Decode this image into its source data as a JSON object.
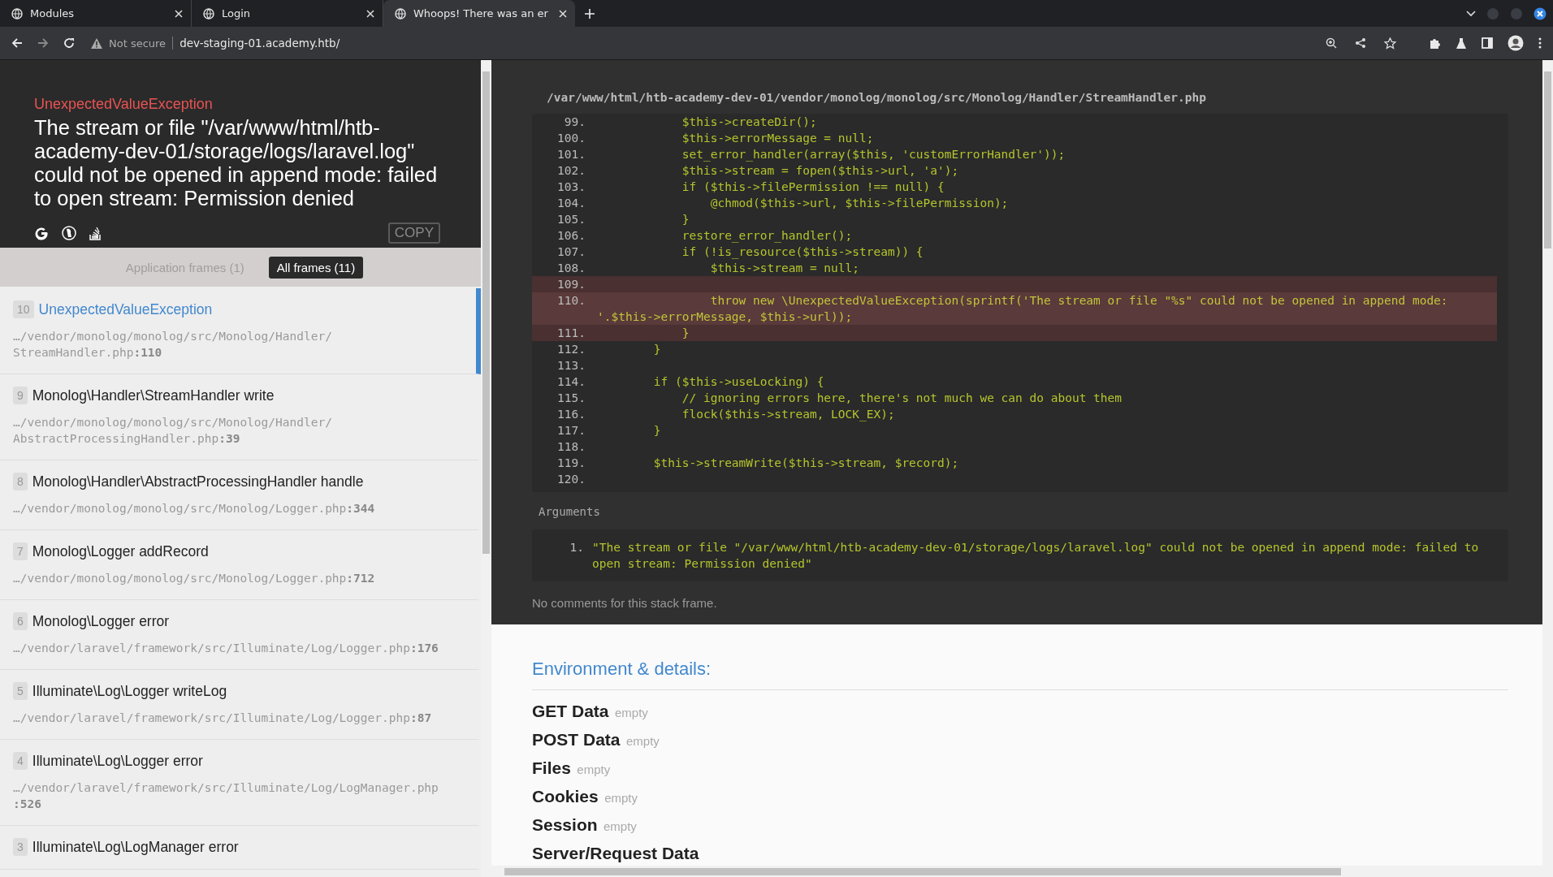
{
  "browser": {
    "tabs": [
      {
        "title": "Modules",
        "selected": false
      },
      {
        "title": "Login",
        "selected": false
      },
      {
        "title": "Whoops! There was an er",
        "selected": true
      }
    ],
    "address": {
      "security": "Not secure",
      "url": "dev-staging-01.academy.htb/"
    }
  },
  "header": {
    "exception": "UnexpectedValueException",
    "message": "The stream or file \"/var/www/html/htb-academy-dev-01/storage/logs/laravel.log\" could not be opened in append mode: failed to open stream: Permission denied",
    "copy_label": "COPY"
  },
  "frame_filters": [
    {
      "label": "Application frames (1)",
      "selected": false
    },
    {
      "label": "All frames (11)",
      "selected": true
    }
  ],
  "frames": [
    {
      "number": "10",
      "title": "UnexpectedValueException",
      "file": "…/vendor/monolog/monolog/src/Monolog/Handler/StreamHandler.php",
      "line": ":110",
      "selected": true
    },
    {
      "number": "9",
      "title": "Monolog\\Handler\\StreamHandler write",
      "file": "…/vendor/monolog/monolog/src/Monolog/Handler/AbstractProcessingHandler.php",
      "line": ":39",
      "selected": false
    },
    {
      "number": "8",
      "title": "Monolog\\Handler\\AbstractProcessingHandler handle",
      "file": "…/vendor/monolog/monolog/src/Monolog/Logger.php",
      "line": ":344",
      "selected": false
    },
    {
      "number": "7",
      "title": "Monolog\\Logger addRecord",
      "file": "…/vendor/monolog/monolog/src/Monolog/Logger.php",
      "line": ":712",
      "selected": false
    },
    {
      "number": "6",
      "title": "Monolog\\Logger error",
      "file": "…/vendor/laravel/framework/src/Illuminate/Log/Logger.php",
      "line": ":176",
      "selected": false
    },
    {
      "number": "5",
      "title": "Illuminate\\Log\\Logger writeLog",
      "file": "…/vendor/laravel/framework/src/Illuminate/Log/Logger.php",
      "line": ":87",
      "selected": false
    },
    {
      "number": "4",
      "title": "Illuminate\\Log\\Logger error",
      "file": "…/vendor/laravel/framework/src/Illuminate/Log/LogManager.php",
      "line": ":526",
      "selected": false
    },
    {
      "number": "3",
      "title": "Illuminate\\Log\\LogManager error",
      "selected": false
    }
  ],
  "code": {
    "file": "/var/www/html/htb-academy-dev-01/vendor/monolog/monolog/src/Monolog/Handler/StreamHandler.php",
    "lines": [
      {
        "number": "99.",
        "text": "            $this->createDir();",
        "highlighted": false
      },
      {
        "number": "100.",
        "text": "            $this->errorMessage = null;",
        "highlighted": false
      },
      {
        "number": "101.",
        "text": "            set_error_handler(array($this, 'customErrorHandler'));",
        "highlighted": false
      },
      {
        "number": "102.",
        "text": "            $this->stream = fopen($this->url, 'a');",
        "highlighted": false
      },
      {
        "number": "103.",
        "text": "            if ($this->filePermission !== null) {",
        "highlighted": false
      },
      {
        "number": "104.",
        "text": "                @chmod($this->url, $this->filePermission);",
        "highlighted": false
      },
      {
        "number": "105.",
        "text": "            }",
        "highlighted": false
      },
      {
        "number": "106.",
        "text": "            restore_error_handler();",
        "highlighted": false
      },
      {
        "number": "107.",
        "text": "            if (!is_resource($this->stream)) {",
        "highlighted": false
      },
      {
        "number": "108.",
        "text": "                $this->stream = null;",
        "highlighted": false
      },
      {
        "number": "109.",
        "highlighted": true
      },
      {
        "number": "110.",
        "text": "                throw new \\UnexpectedValueException(sprintf('The stream or file \"%s\" could not be opened in append mode: '.$this->errorMessage, $this->url));",
        "highlighted": true
      },
      {
        "number": "111.",
        "text": "            }",
        "highlighted": true
      },
      {
        "number": "112.",
        "text": "        }",
        "highlighted": false
      },
      {
        "number": "113.",
        "highlighted": false
      },
      {
        "number": "114.",
        "text": "        if ($this->useLocking) {",
        "highlighted": false
      },
      {
        "number": "115.",
        "text": "            // ignoring errors here, there's not much we can do about them",
        "highlighted": false
      },
      {
        "number": "116.",
        "text": "            flock($this->stream, LOCK_EX);",
        "highlighted": false
      },
      {
        "number": "117.",
        "text": "        }",
        "highlighted": false
      },
      {
        "number": "118.",
        "highlighted": false
      },
      {
        "number": "119.",
        "text": "        $this->streamWrite($this->stream, $record);",
        "highlighted": false
      },
      {
        "number": "120.",
        "highlighted": false
      }
    ]
  },
  "arguments": {
    "label": "Arguments",
    "items": [
      {
        "number": "1.",
        "text": "\"The stream or file \"/var/www/html/htb-academy-dev-01/storage/logs/laravel.log\" could not be opened in append mode: failed to open stream: Permission denied\""
      }
    ]
  },
  "comments": "No comments for this stack frame.",
  "environment": {
    "heading": "Environment & details:",
    "sections": [
      {
        "name": "GET Data",
        "value": "empty"
      },
      {
        "name": "POST Data",
        "value": "empty"
      },
      {
        "name": "Files",
        "value": "empty"
      },
      {
        "name": "Cookies",
        "value": "empty"
      },
      {
        "name": "Session",
        "value": "empty"
      },
      {
        "name": "Server/Request Data"
      }
    ]
  }
}
